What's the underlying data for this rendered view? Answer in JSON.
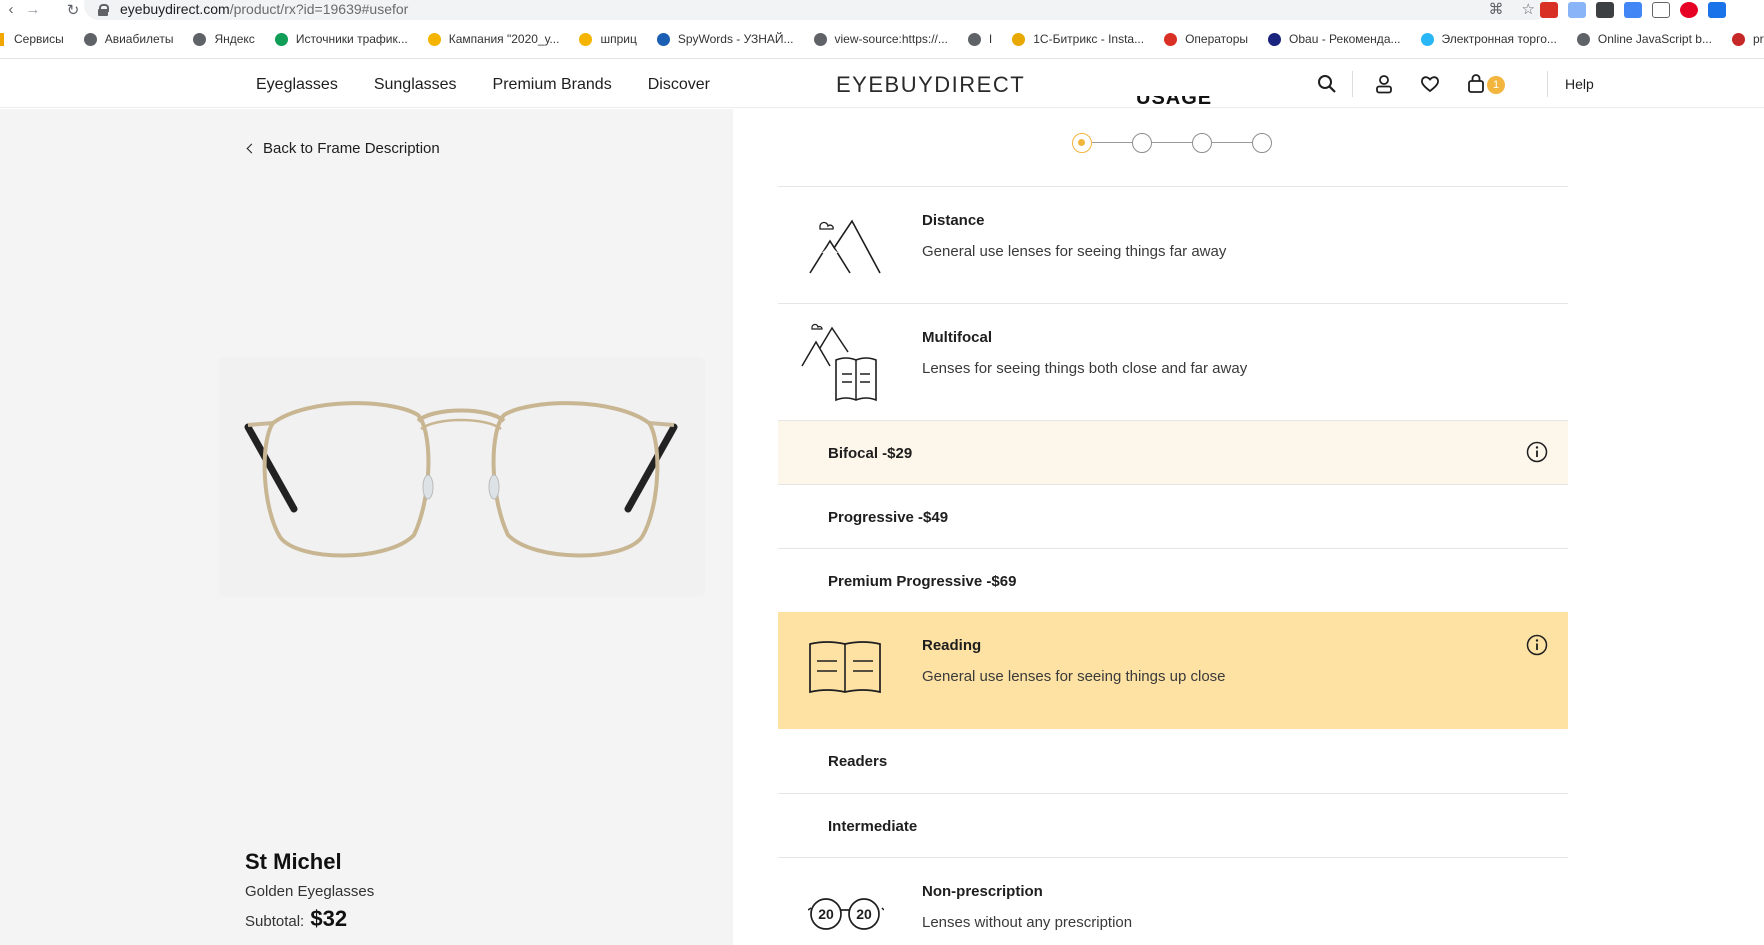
{
  "browser": {
    "url_host": "eyebuydirect.com",
    "url_path": "/product/rx?id=19639#usefor",
    "bookmarks": [
      {
        "label": "Сервисы",
        "color": "#f2a600"
      },
      {
        "label": "Авиабилеты",
        "color": "#5f6368"
      },
      {
        "label": "Яндекс",
        "color": "#5f6368"
      },
      {
        "label": "Источники трафик...",
        "color": "#0f9d58"
      },
      {
        "label": "Кампания \"2020_у...",
        "color": "#f4b400"
      },
      {
        "label": "шприц",
        "color": "#f4b400"
      },
      {
        "label": "SpyWords - УЗНАЙ...",
        "color": "#1a5fb4"
      },
      {
        "label": "view-source:https://...",
        "color": "#5f6368"
      },
      {
        "label": "I",
        "color": "#5f6368"
      },
      {
        "label": "1С-Битрикс - Insta...",
        "color": "#e8a800"
      },
      {
        "label": "Операторы",
        "color": "#d93025"
      },
      {
        "label": "Obau - Рекоменда...",
        "color": "#1a237e"
      },
      {
        "label": "Электронная торго...",
        "color": "#29b6f6"
      },
      {
        "label": "Online JavaScript b...",
        "color": "#5f6368"
      },
      {
        "label": "prt",
        "color": "#c62828"
      }
    ]
  },
  "header": {
    "nav": [
      "Eyeglasses",
      "Sunglasses",
      "Premium Brands",
      "Discover"
    ],
    "logo": "EYEBUYDIRECT",
    "cart_count": "1",
    "help": "Help",
    "accent_color": "#f2b53d"
  },
  "product": {
    "back_label": "Back to Frame Description",
    "name": "St Michel",
    "subtitle": "Golden Eyeglasses",
    "subtotal_label": "Subtotal:",
    "subtotal_value": "$32"
  },
  "lens": {
    "step_title": "USAGE",
    "steps": 4,
    "active_step": 1,
    "options": {
      "distance": {
        "title": "Distance",
        "desc": "General use lenses for seeing things far away",
        "icon": "mountains-icon"
      },
      "multifocal": {
        "title": "Multifocal",
        "desc": "Lenses for seeing things both close and far away",
        "icon": "mountains-book-icon"
      },
      "bifocal": {
        "title": "Bifocal -$29"
      },
      "progressive": {
        "title": "Progressive -$49"
      },
      "premium_progressive": {
        "title": "Premium Progressive -$69"
      },
      "reading": {
        "title": "Reading",
        "desc": "General use lenses for seeing things up close",
        "icon": "open-book-icon"
      },
      "readers": {
        "title": "Readers"
      },
      "intermediate": {
        "title": "Intermediate"
      },
      "nonprescription": {
        "title": "Non-prescription",
        "desc": "Lenses without any prescription",
        "icon": "20-20-glasses-icon"
      }
    }
  }
}
